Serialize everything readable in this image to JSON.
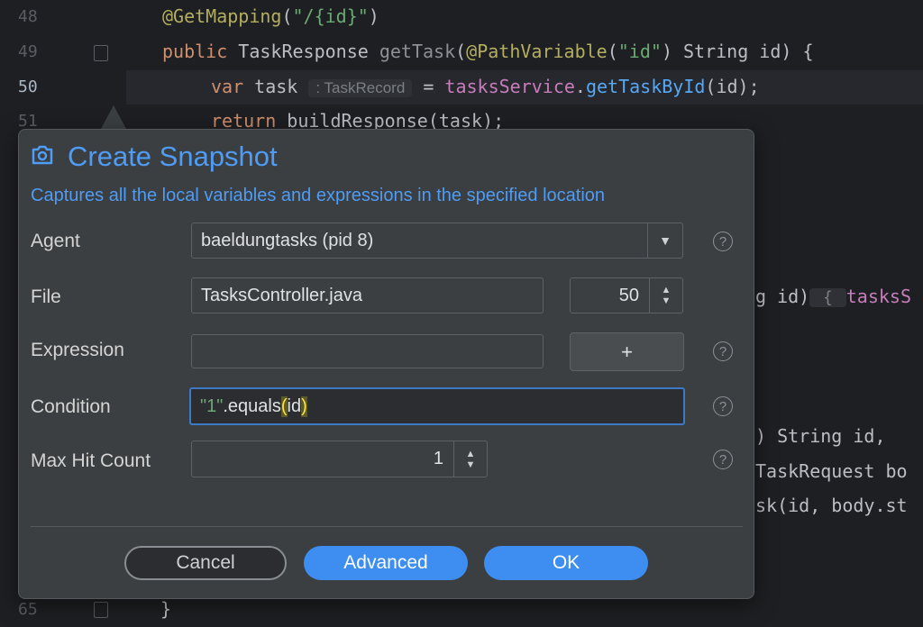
{
  "editor": {
    "line_numbers": [
      "48",
      "49",
      "50",
      "51",
      "65"
    ],
    "lines": {
      "l48_ann": "@GetMapping",
      "l48_rest_open": "(",
      "l48_str": "\"/{id}\"",
      "l48_rest_close": ")",
      "l49_kw": "public",
      "l49_type": " TaskResponse ",
      "l49_method": "getTask",
      "l49_paren": "(",
      "l49_ann": "@PathVariable",
      "l49_open": "(",
      "l49_str": "\"id\"",
      "l49_tail": ") String id) {",
      "l50_kw": "var",
      "l50_name": " task ",
      "l50_hint": ": TaskRecord",
      "l50_eq": " = ",
      "l50_field": "tasksService",
      "l50_dot": ".",
      "l50_call": "getTaskById",
      "l50_tail": "(id);",
      "l51_kw": "return",
      "l51_tail": " buildResponse(task);",
      "r1_text": "g id)",
      "r1_brace": " { ",
      "r1_field": "tasksS",
      "r2_text": ") String id,",
      "r3_text": "TaskRequest bo",
      "r4_text": "sk(id, body.st",
      "l65_text": "}"
    }
  },
  "dialog": {
    "title": "Create Snapshot",
    "subtitle": "Captures all the local variables and expressions in the specified location",
    "agent_label": "Agent",
    "agent_value": "baeldungtasks (pid 8)",
    "file_label": "File",
    "file_value": "TasksController.java",
    "line_value": "50",
    "expression_label": "Expression",
    "expression_value": "",
    "plus_label": "+",
    "condition_label": "Condition",
    "condition_str": "\"1\"",
    "condition_mid": ".equals",
    "condition_open": "(",
    "condition_arg": "id",
    "condition_close": ")",
    "max_hit_label": "Max Hit Count",
    "max_hit_value": "1",
    "help_glyph": "?",
    "cancel_label": "Cancel",
    "advanced_label": "Advanced",
    "ok_label": "OK"
  },
  "colors": {
    "accent": "#3d8ef0",
    "title_blue": "#4e9cf5",
    "dialog_bg": "#3c3f41",
    "editor_bg": "#1e1f22"
  },
  "icons": [
    "camera-icon",
    "chevron-down-icon",
    "spinner-arrows-icon",
    "help-icon",
    "fold-marker-icon"
  ]
}
